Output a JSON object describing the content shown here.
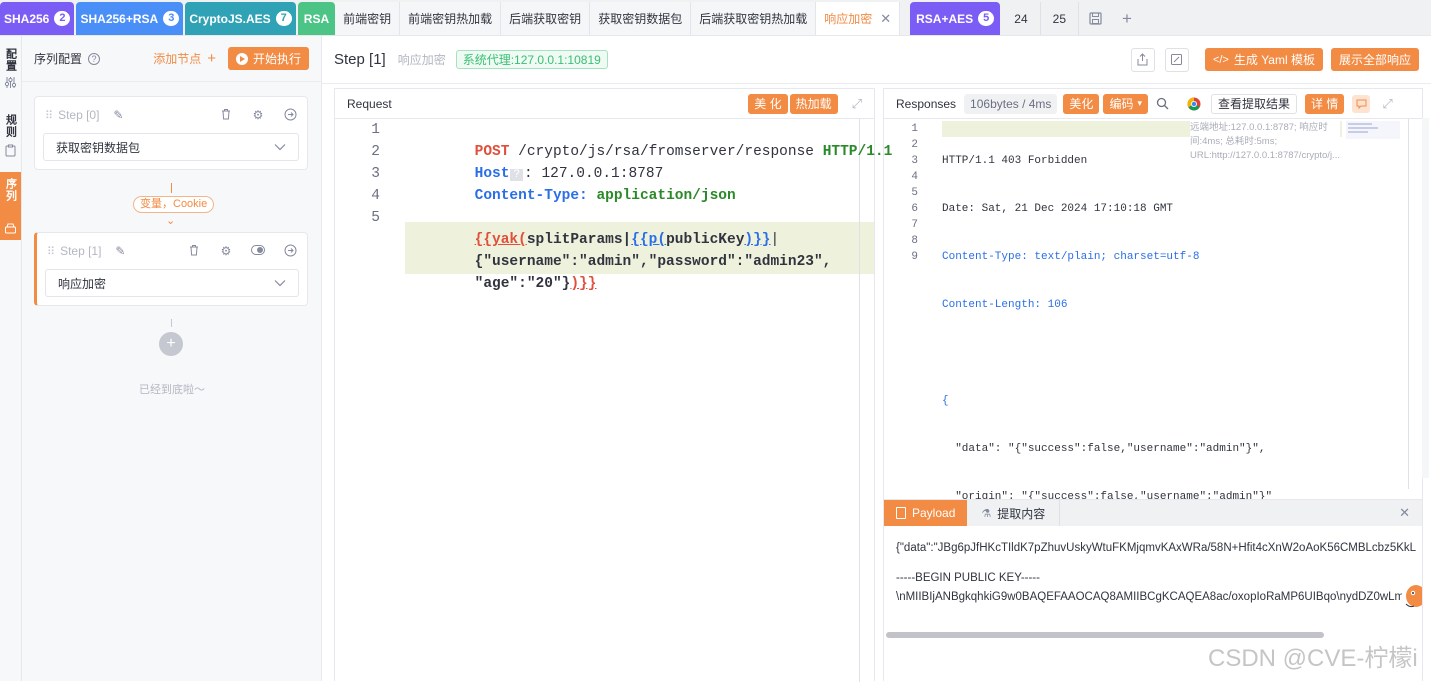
{
  "tabs": {
    "groups": [
      {
        "label": "SHA256",
        "count": "2",
        "color": "#7b5cf5"
      },
      {
        "label": "SHA256+RSA",
        "count": "3",
        "color": "#4a8ef7"
      },
      {
        "label": "CryptoJS.AES",
        "count": "7",
        "color": "#2fa2b5"
      },
      {
        "label": "RSA",
        "count": "",
        "color": "#4bc486"
      }
    ],
    "subtabs": [
      "前端密钥",
      "前端密钥热加载",
      "后端获取密钥",
      "获取密钥数据包",
      "后端获取密钥热加载",
      "响应加密"
    ],
    "group2": {
      "label": "RSA+AES",
      "count": "5",
      "color": "#7b5cf5"
    },
    "plain": [
      "24",
      "25"
    ]
  },
  "rail": {
    "config": "配置",
    "rules": "规则",
    "seq": "序列"
  },
  "sequence": {
    "title": "序列配置",
    "add_node": "添加节点",
    "start": "开始执行",
    "step0": {
      "label": "Step [0]",
      "value": "获取密钥数据包"
    },
    "connector": "变量，Cookie",
    "step1": {
      "label": "Step [1]",
      "value": "响应加密"
    },
    "end_text": "已经到底啦～"
  },
  "header": {
    "step": "Step [1]",
    "name": "响应加密",
    "proxy": "系统代理:127.0.0.1:10819",
    "gen_yaml": "生成 Yaml 模板",
    "show_all": "展示全部响应"
  },
  "request": {
    "title": "Request",
    "beautify": "美 化",
    "hotload": "热加载",
    "lines": {
      "l1_method": "POST",
      "l1_path": " /crypto/js/rsa/fromserver/response ",
      "l1_ver": "HTTP/1.1",
      "l2_key": "Host",
      "l2_val": ": 127.0.0.1:8787",
      "l3_key": "Content-Type:",
      "l3_val": " application/json",
      "l5_a": "{{yak(",
      "l5_b": "splitParams|",
      "l5_c": "{{p(",
      "l5_d": "publicKey",
      "l5_e": ")}}",
      "l5_f": "|",
      "l6": "{\"username\":\"admin\",\"password\":\"admin23\",",
      "l7_a": "\"age\":\"20\"}",
      "l7_b": ")}}"
    }
  },
  "response": {
    "title": "Responses",
    "size": "106bytes / 4ms",
    "beautify": "美化",
    "encode": "编码",
    "view_extract": "查看提取结果",
    "detail": "详 情",
    "lines": [
      "HTTP/1.1 403 Forbidden",
      "Date: Sat, 21 Dec 2024 17:10:18 GMT",
      "Content-Type: text/plain; charset=utf-8",
      "Content-Length: 106",
      "",
      "{",
      "  \"data\": \"{\"success\":false,\"username\":\"admin\"}\",",
      "  \"origin\": \"{\"success\":false,\"username\":\"admin\"}\"",
      "}"
    ],
    "remote_info": "远端地址:127.0.0.1:8787; 响应时间:4ms; 总耗时:5ms; URL:http://127.0.0.1:8787/crypto/j..."
  },
  "bottom": {
    "tab_payload": "Payload",
    "tab_extract": "提取内容",
    "payload_line1": "{\"data\":\"JBg6pJfHKcTIldK7pZhuvUskyWtuFKMjqmvKAxWRa/58N+Hfit4cXnW2oAoK56CMBLcbz5KkL",
    "payload_line2": "-----BEGIN PUBLIC KEY-----",
    "payload_line3": "\\nMIIBIjANBgkqhkiG9w0BAQEFAAOCAQ8AMIIBCgKCAQEA8ac/oxopIoRaMP6UIBqo\\nydDZ0wLm..."
  },
  "watermark": "CSDN @CVE-柠檬i",
  "colors": {
    "accent": "#f28b44",
    "keyword": "#e04f3b",
    "header_key": "#2b6fe8",
    "string_green": "#2a8a2a"
  }
}
